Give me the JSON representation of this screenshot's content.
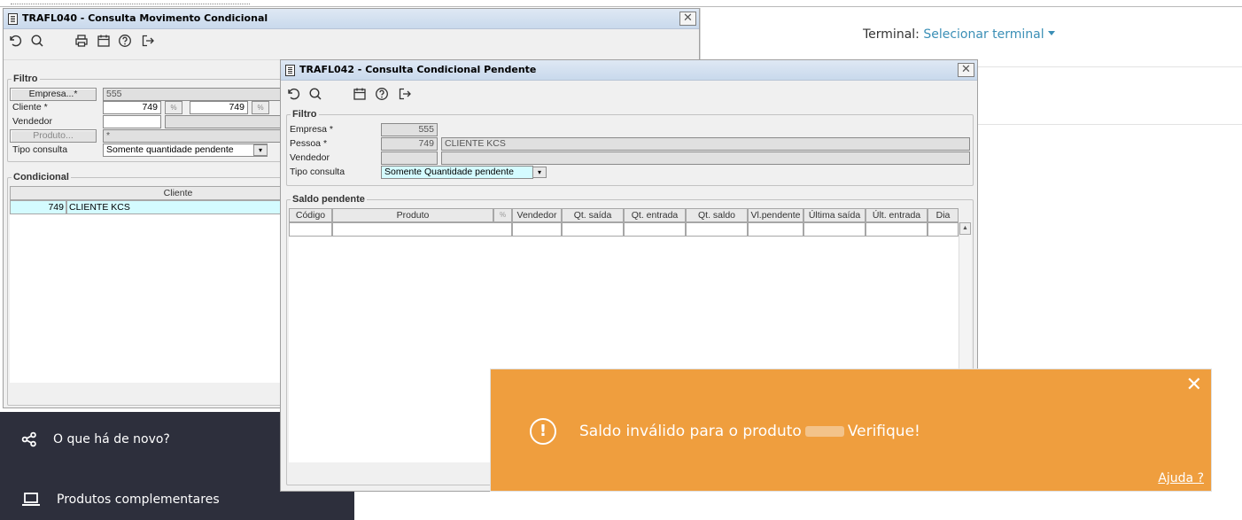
{
  "terminal": {
    "label": "Terminal:",
    "value": "Selecionar terminal"
  },
  "win1": {
    "title": "TRAFL040 - Consulta Movimento Condicional",
    "close": "✕",
    "filtro": {
      "legend": "Filtro",
      "empresa_btn": "Empresa...*",
      "empresa_val": "555",
      "cliente_lbl": "Cliente *",
      "cliente_de": "749",
      "cliente_ate": "749",
      "vendedor_lbl": "Vendedor",
      "produto_btn": "Produto...",
      "produto_val": "*",
      "tipo_lbl": "Tipo consulta",
      "tipo_val": "Somente quantidade pendente"
    },
    "condicional": {
      "legend": "Condicional",
      "col_cliente": "Cliente",
      "row_code": "749",
      "row_name": "CLIENTE  KCS"
    }
  },
  "win2": {
    "title": "TRAFL042 - Consulta Condicional Pendente",
    "close": "✕",
    "filtro": {
      "legend": "Filtro",
      "empresa_lbl": "Empresa *",
      "empresa_val": "555",
      "pessoa_lbl": "Pessoa *",
      "pessoa_code": "749",
      "pessoa_name": "CLIENTE  KCS",
      "vendedor_lbl": "Vendedor",
      "tipo_lbl": "Tipo consulta",
      "tipo_val": "Somente Quantidade pendente"
    },
    "saldo": {
      "legend": "Saldo pendente",
      "columns": [
        "Código",
        "Produto",
        "Vendedor",
        "Qt. saída",
        "Qt. entrada",
        "Qt. saldo",
        "Vl.pendente",
        "Última saída",
        "Últ. entrada",
        "Dia"
      ]
    }
  },
  "menu": {
    "items": [
      {
        "label": "O que há de novo?",
        "icon": "share-icon"
      },
      {
        "label": "Produtos complementares",
        "icon": "laptop-icon"
      }
    ]
  },
  "toast": {
    "message_before": "Saldo inválido para o produto",
    "message_after": "Verifique!",
    "help": "Ajuda ?",
    "close": "✕",
    "icon": "!",
    "color": "#ef9e3e"
  }
}
